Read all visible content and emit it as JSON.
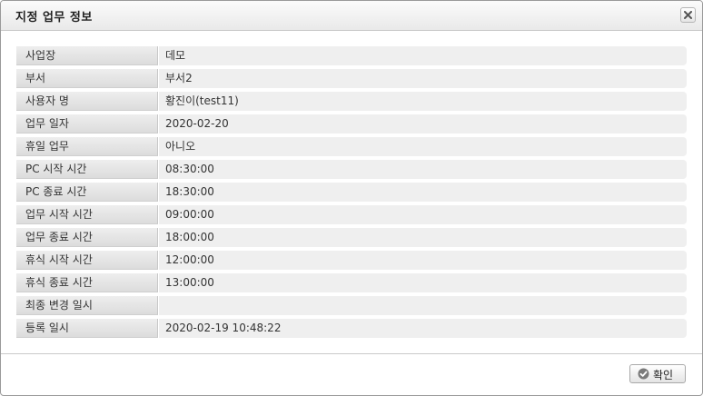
{
  "dialog": {
    "title": "지정 업무 정보",
    "close_icon": "close-x-icon"
  },
  "rows": [
    {
      "label": "사업장",
      "value": "데모"
    },
    {
      "label": "부서",
      "value": "부서2"
    },
    {
      "label": "사용자 명",
      "value": "황진이(test11)"
    },
    {
      "label": "업무 일자",
      "value": "2020-02-20"
    },
    {
      "label": "휴일 업무",
      "value": "아니오"
    },
    {
      "label": "PC 시작 시간",
      "value": "08:30:00"
    },
    {
      "label": "PC 종료 시간",
      "value": "18:30:00"
    },
    {
      "label": "업무 시작 시간",
      "value": "09:00:00"
    },
    {
      "label": "업무 종료 시간",
      "value": "18:00:00"
    },
    {
      "label": "휴식 시작 시간",
      "value": "12:00:00"
    },
    {
      "label": "휴식 종료 시간",
      "value": "13:00:00"
    },
    {
      "label": "최종 변경 일시",
      "value": ""
    },
    {
      "label": "등록 일시",
      "value": "2020-02-19 10:48:22"
    }
  ],
  "footer": {
    "confirm_label": "확인",
    "confirm_icon": "check-circle-icon"
  }
}
